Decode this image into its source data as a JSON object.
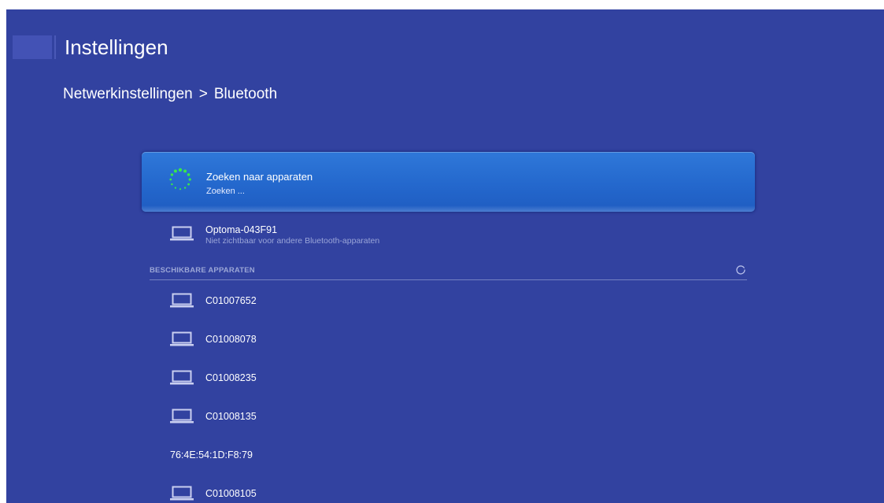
{
  "header": {
    "title": "Instellingen",
    "breadcrumb": {
      "parent": "Netwerkinstellingen",
      "separator": ">",
      "current": "Bluetooth"
    }
  },
  "search": {
    "title": "Zoeken naar apparaten",
    "status": "Zoeken ...",
    "icon": "loading-spinner-icon",
    "spinner_color": "#39e84a"
  },
  "own_device": {
    "name": "Optoma-043F91",
    "visibility": "Niet zichtbaar voor andere Bluetooth-apparaten",
    "icon": "laptop-icon"
  },
  "available": {
    "header": "BESCHIKBARE APPARATEN",
    "refresh_icon": "refresh-icon",
    "devices": [
      {
        "name": "C01007652",
        "icon": "laptop-icon"
      },
      {
        "name": "C01008078",
        "icon": "laptop-icon"
      },
      {
        "name": "C01008235",
        "icon": "laptop-icon"
      },
      {
        "name": "C01008135",
        "icon": "laptop-icon"
      },
      {
        "name": "76:4E:54:1D:F8:79",
        "icon": ""
      },
      {
        "name": "C01008105",
        "icon": "laptop-icon"
      }
    ]
  },
  "colors": {
    "background": "#3242a0",
    "card": "#2468cd",
    "muted_text": "#9aa5d8",
    "icon_light": "#c9cff0"
  }
}
